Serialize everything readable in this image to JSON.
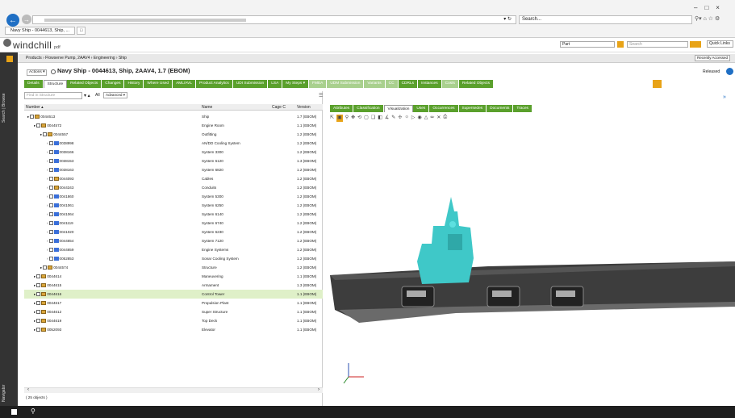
{
  "browser": {
    "tab_label": "Navy Ship - 0044613, Ship, ...",
    "search_placeholder": "Search...",
    "window_controls": [
      "–",
      "□",
      "×"
    ]
  },
  "header": {
    "logo": "windchill",
    "logo_suffix": "pdf",
    "part_select": "Part",
    "search_placeholder": "Search",
    "quick_links": "Quick Links"
  },
  "breadcrumb": "Products › Flowserve Pump, 2AAV4 › Engineering › Ship",
  "recently_accessed": "Recently Accessed",
  "page": {
    "title": "Navy Ship - 0044613, Ship, 2AAV4, 1.7 (EBOM)",
    "actions": "Actions ▾",
    "status": "Released"
  },
  "main_tabs": [
    {
      "label": "Details",
      "state": "normal"
    },
    {
      "label": "Structure",
      "state": "active"
    },
    {
      "label": "Related Objects",
      "state": "normal"
    },
    {
      "label": "Changes",
      "state": "normal"
    },
    {
      "label": "History",
      "state": "normal"
    },
    {
      "label": "Where Used",
      "state": "normal"
    },
    {
      "label": "AML/AVL",
      "state": "normal"
    },
    {
      "label": "Product Analytics",
      "state": "normal"
    },
    {
      "label": "UDI Submission",
      "state": "normal"
    },
    {
      "label": "LSA",
      "state": "normal"
    },
    {
      "label": "My Steps ▾",
      "state": "normal"
    },
    {
      "label": "FMEA",
      "state": "dis"
    },
    {
      "label": "UDM Submission",
      "state": "dis"
    },
    {
      "label": "Variants",
      "state": "dis"
    },
    {
      "label": "CC",
      "state": "dis"
    },
    {
      "label": "CDRLs",
      "state": "normal"
    },
    {
      "label": "Instances",
      "state": "normal"
    },
    {
      "label": "Costs",
      "state": "dis"
    },
    {
      "label": "Related Objects",
      "state": "normal"
    }
  ],
  "tree": {
    "find_placeholder": "Find in Structure",
    "view_label": "All",
    "advanced": "Advanced ▾",
    "col_number": "Number ▴",
    "col_name": "Name",
    "col_cage": "Cage C",
    "col_version": "Version",
    "footer": "( 25 objects )",
    "rows": [
      {
        "indent": 0,
        "number": "0044613",
        "name": "Ship",
        "version": "1.7 (EBOM)",
        "icon": "part"
      },
      {
        "indent": 1,
        "number": "0044572",
        "name": "Engine Room",
        "version": "1.1 (EBOM)",
        "icon": "part"
      },
      {
        "indent": 2,
        "number": "0044557",
        "name": "Outfitting",
        "version": "1.2 (EBOM)",
        "icon": "part"
      },
      {
        "indent": 3,
        "number": "0038998",
        "name": "AN/DD Cooling System",
        "version": "1.2 (EBOM)",
        "icon": "asm"
      },
      {
        "indent": 3,
        "number": "0038166",
        "name": "System 3300",
        "version": "1.2 (EBOM)",
        "icon": "asm"
      },
      {
        "indent": 3,
        "number": "0038153",
        "name": "System 6120",
        "version": "1.3 (EBOM)",
        "icon": "asm"
      },
      {
        "indent": 3,
        "number": "0038163",
        "name": "System 6820",
        "version": "1.2 (EBOM)",
        "icon": "asm"
      },
      {
        "indent": 3,
        "number": "0044093",
        "name": "Cables",
        "version": "1.2 (EBOM)",
        "icon": "part"
      },
      {
        "indent": 3,
        "number": "0044343",
        "name": "Conduits",
        "version": "1.2 (EBOM)",
        "icon": "part"
      },
      {
        "indent": 3,
        "number": "0041860",
        "name": "System 5300",
        "version": "1.2 (EBOM)",
        "icon": "asm"
      },
      {
        "indent": 3,
        "number": "0041061",
        "name": "System 6250",
        "version": "1.2 (EBOM)",
        "icon": "asm"
      },
      {
        "indent": 3,
        "number": "0041064",
        "name": "System 6140",
        "version": "1.2 (EBOM)",
        "icon": "asm"
      },
      {
        "indent": 3,
        "number": "0041119",
        "name": "System 6740",
        "version": "1.2 (EBOM)",
        "icon": "asm"
      },
      {
        "indent": 3,
        "number": "0041020",
        "name": "System 6230",
        "version": "1.2 (EBOM)",
        "icon": "asm"
      },
      {
        "indent": 3,
        "number": "0044654",
        "name": "System 7120",
        "version": "1.2 (EBOM)",
        "icon": "asm"
      },
      {
        "indent": 3,
        "number": "0044659",
        "name": "Engine Systems",
        "version": "1.2 (EBOM)",
        "icon": "asm"
      },
      {
        "indent": 3,
        "number": "0052853",
        "name": "Sonar Cooling System",
        "version": "1.2 (EBOM)",
        "icon": "asm"
      },
      {
        "indent": 2,
        "number": "0044574",
        "name": "Structure",
        "version": "1.2 (EBOM)",
        "icon": "part"
      },
      {
        "indent": 1,
        "number": "0044614",
        "name": "Maneuvering",
        "version": "1.1 (EBOM)",
        "icon": "part"
      },
      {
        "indent": 1,
        "number": "0044615",
        "name": "Armament",
        "version": "1.3 (EBOM)",
        "icon": "part"
      },
      {
        "indent": 1,
        "number": "0044616",
        "name": "Control Tower",
        "version": "1.1 (EBOM)",
        "icon": "part",
        "highlight": true
      },
      {
        "indent": 1,
        "number": "0044617",
        "name": "Propulsion Plant",
        "version": "1.1 (EBOM)",
        "icon": "part"
      },
      {
        "indent": 1,
        "number": "0044612",
        "name": "Super Structure",
        "version": "1.1 (EBOM)",
        "icon": "part"
      },
      {
        "indent": 1,
        "number": "0044619",
        "name": "Top Deck",
        "version": "1.1 (EBOM)",
        "icon": "part"
      },
      {
        "indent": 1,
        "number": "0052093",
        "name": "Elevator",
        "version": "1.1 (EBOM)",
        "icon": "part"
      }
    ]
  },
  "vis_tabs": [
    {
      "label": "Attributes",
      "active": false
    },
    {
      "label": "Classification",
      "active": false
    },
    {
      "label": "Visualization",
      "active": true
    },
    {
      "label": "Uses",
      "active": false
    },
    {
      "label": "Occurrences",
      "active": false
    },
    {
      "label": "Supersedes",
      "active": false
    },
    {
      "label": "Documents",
      "active": false
    },
    {
      "label": "Traces",
      "active": false
    }
  ],
  "left_rail": {
    "top": "Search | Browse",
    "bottom": "Navigator"
  },
  "colors": {
    "green": "#5aa02c",
    "hull": "#3a3a3a",
    "tower": "#3fc8c8"
  }
}
